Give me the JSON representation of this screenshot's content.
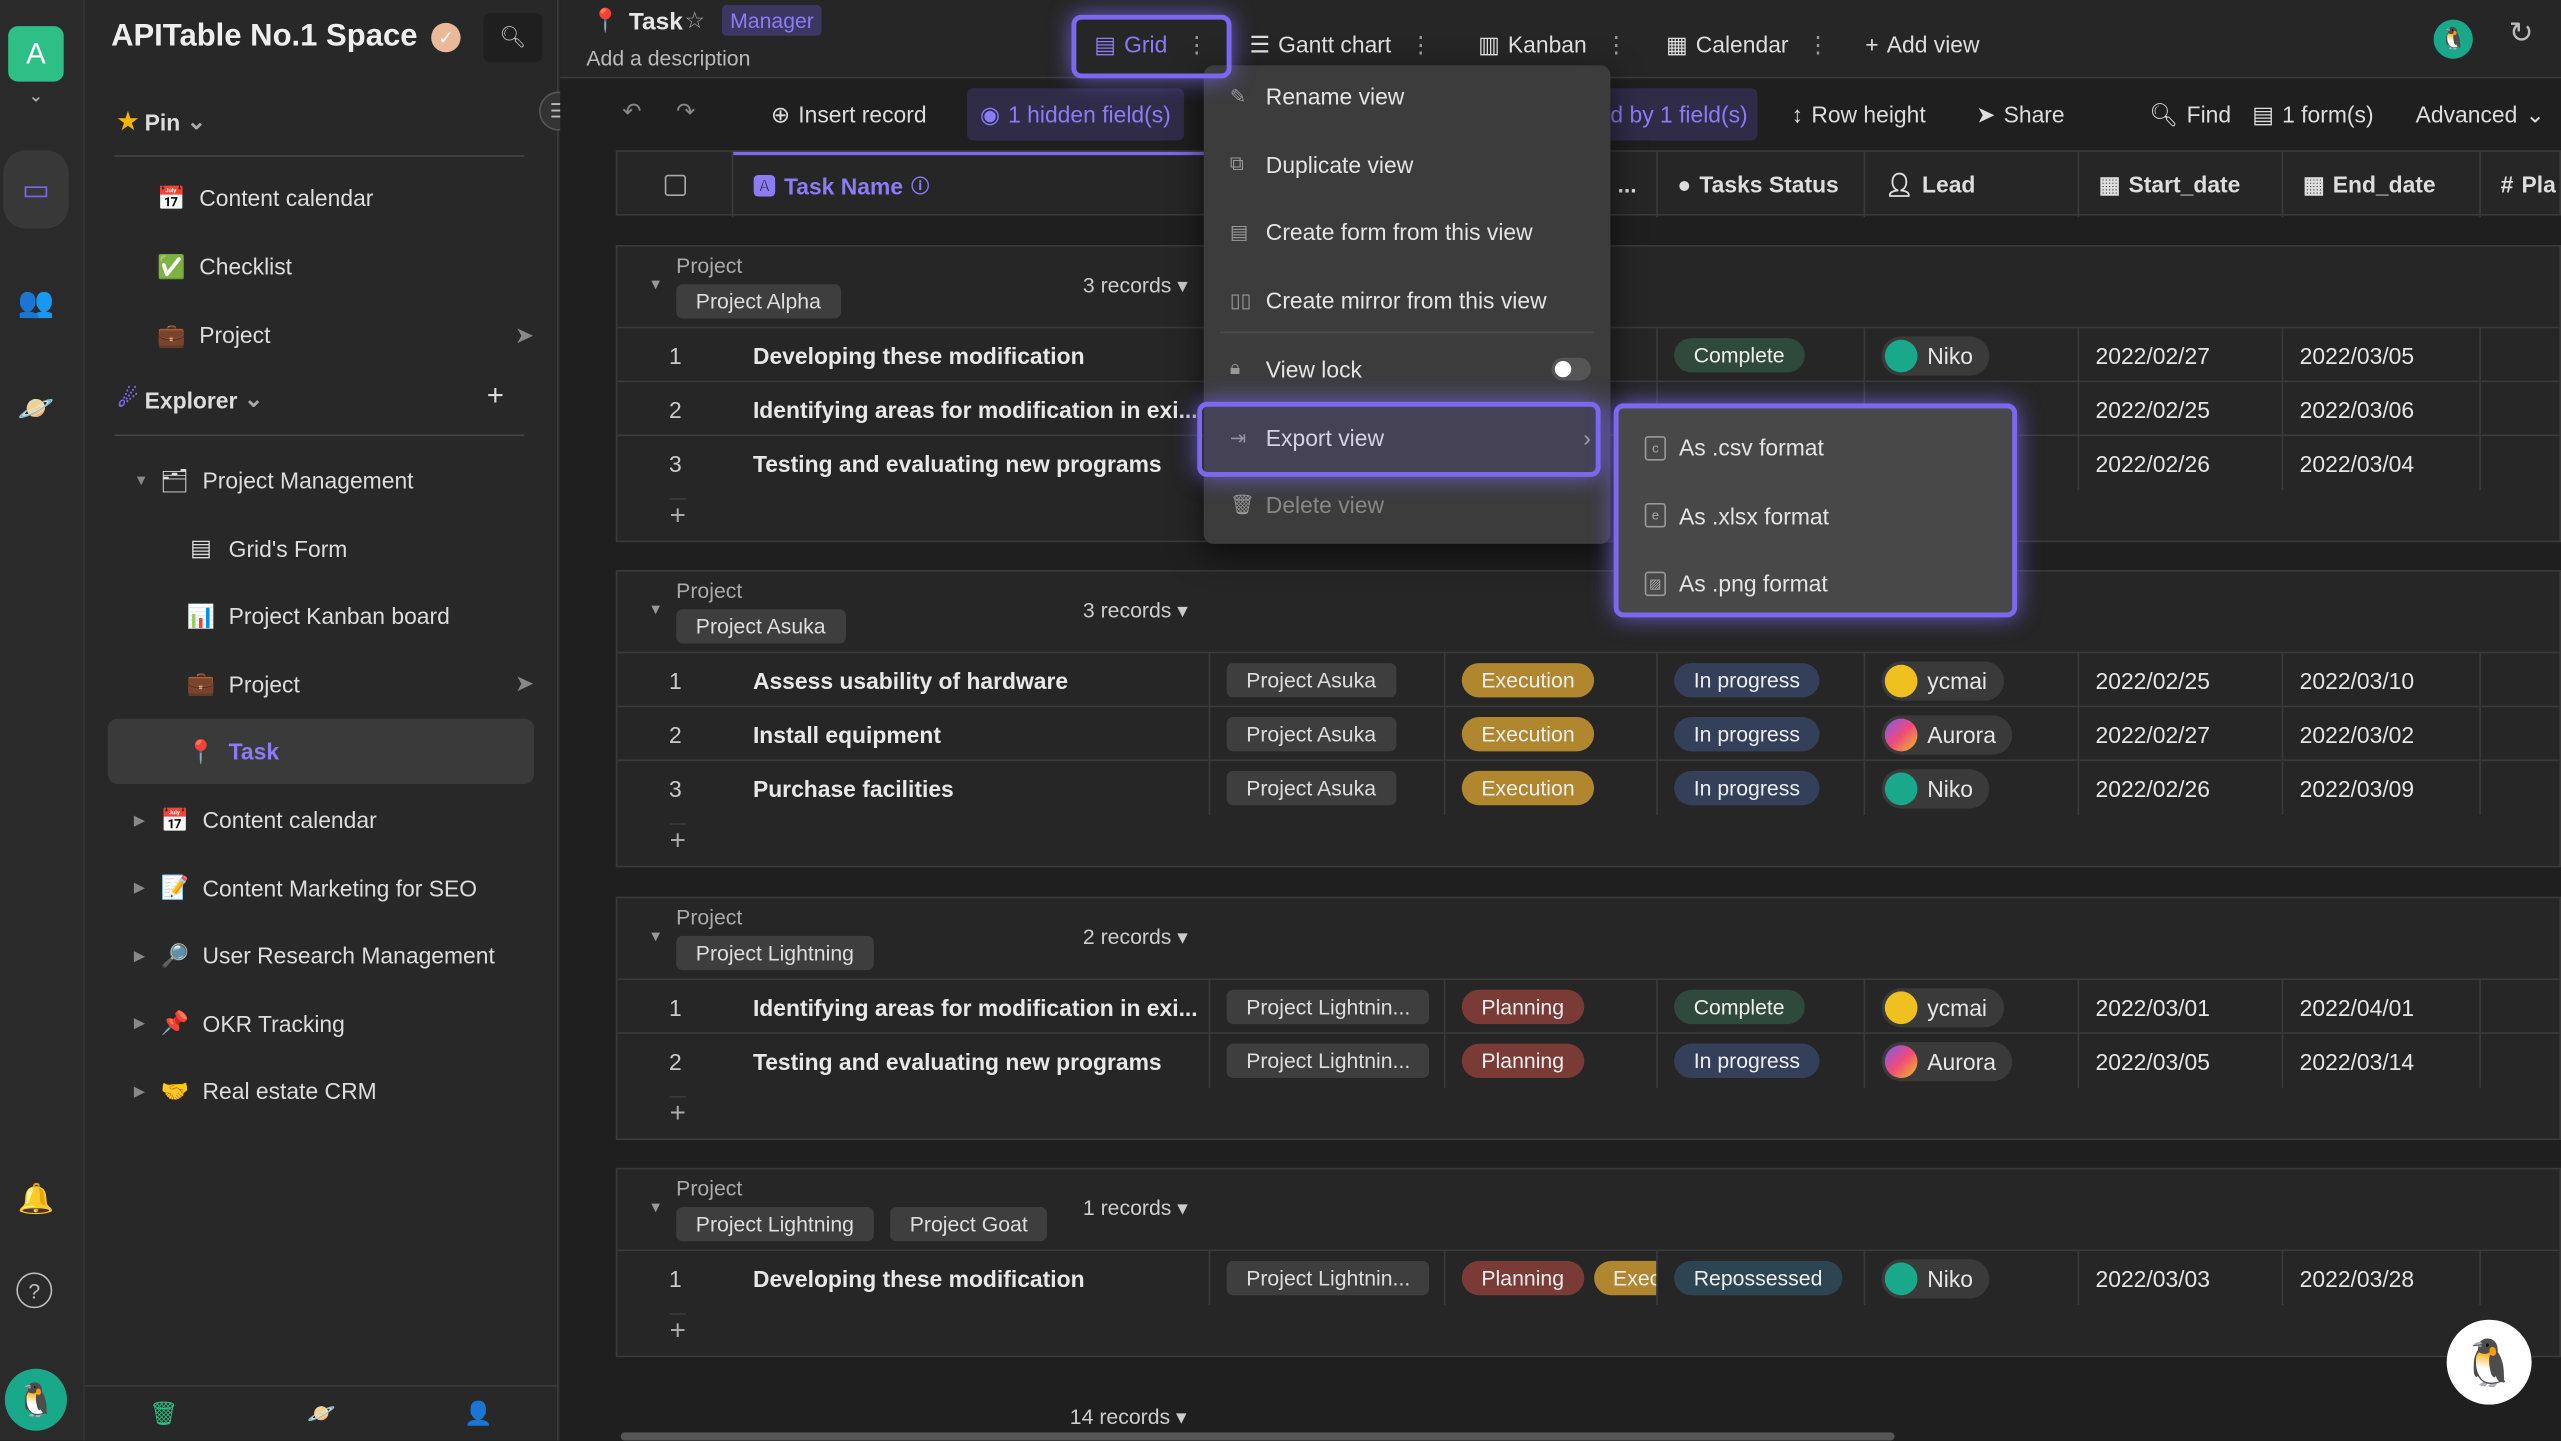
{
  "colors": {
    "accent": "#7b68ee",
    "complete": "#2f4a3c",
    "in_progress": "#34405a",
    "execution": "#b0862e",
    "planning": "#7a3a36",
    "repossessed": "#2d4552",
    "space_avatar": "#2dbf86"
  },
  "rail": {
    "space_letter": "A"
  },
  "sidebar": {
    "space_name": "APITable No.1 Space",
    "pin_label": "Pin",
    "pins": [
      {
        "icon": "📅",
        "label": "Content calendar"
      },
      {
        "icon": "✅",
        "label": "Checklist"
      },
      {
        "icon": "💼",
        "label": "Project"
      }
    ],
    "explorer_label": "Explorer",
    "tree": [
      {
        "icon": "🗂",
        "label": "Project Management",
        "level": 0,
        "expanded": true
      },
      {
        "icon": "▤",
        "label": "Grid's Form",
        "level": 1
      },
      {
        "icon": "📊",
        "label": "Project Kanban board",
        "level": 1
      },
      {
        "icon": "💼",
        "label": "Project",
        "level": 1,
        "shared": true
      },
      {
        "icon": "📍",
        "label": "Task",
        "level": 1,
        "active": true
      },
      {
        "icon": "📅",
        "label": "Content calendar",
        "level": 0
      },
      {
        "icon": "📝",
        "label": "Content Marketing for SEO",
        "level": 0
      },
      {
        "icon": "🔎",
        "label": "User Research Management",
        "level": 0
      },
      {
        "icon": "📌",
        "label": "OKR Tracking",
        "level": 0
      },
      {
        "icon": "🤝",
        "label": "Real estate CRM",
        "level": 0
      }
    ]
  },
  "header": {
    "title": "Task",
    "role": "Manager",
    "description": "Add a description",
    "views": [
      {
        "label": "Grid",
        "icon": "grid-icon",
        "active": true
      },
      {
        "label": "Gantt chart",
        "icon": "gantt-icon"
      },
      {
        "label": "Kanban",
        "icon": "kanban-icon"
      },
      {
        "label": "Calendar",
        "icon": "calendar-icon"
      }
    ],
    "add_view": "Add view"
  },
  "toolbar": {
    "insert": "Insert record",
    "hidden": "1 hidden field(s)",
    "grouped": "d by 1 field(s)",
    "row_height": "Row height",
    "share": "Share",
    "find": "Find",
    "forms": "1 form(s)",
    "advanced": "Advanced"
  },
  "columns": {
    "task": "Task Name",
    "truncated": "...",
    "status": "Tasks Status",
    "lead": "Lead",
    "start": "Start_date",
    "end": "End_date",
    "pla": "Pla"
  },
  "group_field": "Project",
  "groups": [
    {
      "tags": [
        "Project Alpha"
      ],
      "count": "3 records",
      "rows": [
        {
          "n": "1",
          "task": "Developing these modification",
          "status": "Complete",
          "lead": "Niko",
          "start": "2022/02/27",
          "end": "2022/03/05"
        },
        {
          "n": "2",
          "task": "Identifying areas for modification in exi...",
          "start": "2022/02/25",
          "end": "2022/03/06"
        },
        {
          "n": "3",
          "task": "Testing and evaluating new programs",
          "start": "2022/02/26",
          "end": "2022/03/04"
        }
      ]
    },
    {
      "tags": [
        "Project Asuka"
      ],
      "count": "3 records",
      "rows": [
        {
          "n": "1",
          "task": "Assess usability of hardware",
          "project": "Project Asuka",
          "phase": [
            "Execution"
          ],
          "status": "In progress",
          "lead": "ycmai",
          "start": "2022/02/25",
          "end": "2022/03/10"
        },
        {
          "n": "2",
          "task": "Install equipment",
          "project": "Project Asuka",
          "phase": [
            "Execution"
          ],
          "status": "In progress",
          "lead": "Aurora",
          "start": "2022/02/27",
          "end": "2022/03/02"
        },
        {
          "n": "3",
          "task": "Purchase facilities",
          "project": "Project Asuka",
          "phase": [
            "Execution"
          ],
          "status": "In progress",
          "lead": "Niko",
          "start": "2022/02/26",
          "end": "2022/03/09"
        }
      ]
    },
    {
      "tags": [
        "Project Lightning"
      ],
      "count": "2 records",
      "rows": [
        {
          "n": "1",
          "task": "Identifying areas for modification in exi...",
          "project": "Project Lightnin...",
          "phase": [
            "Planning"
          ],
          "status": "Complete",
          "lead": "ycmai",
          "start": "2022/03/01",
          "end": "2022/04/01"
        },
        {
          "n": "2",
          "task": "Testing and evaluating new programs",
          "project": "Project Lightnin...",
          "phase": [
            "Planning"
          ],
          "status": "In progress",
          "lead": "Aurora",
          "start": "2022/03/05",
          "end": "2022/03/14"
        }
      ]
    },
    {
      "tags": [
        "Project Lightning",
        "Project Goat"
      ],
      "count": "1 records",
      "rows": [
        {
          "n": "1",
          "task": "Developing these modification",
          "project": "Project Lightnin...",
          "phase": [
            "Planning",
            "Execu"
          ],
          "status": "Repossessed",
          "lead": "Niko",
          "start": "2022/03/03",
          "end": "2022/03/28"
        }
      ]
    }
  ],
  "footer": {
    "total": "14 records"
  },
  "view_menu": {
    "items": [
      {
        "label": "Rename view"
      },
      {
        "label": "Duplicate view"
      },
      {
        "label": "Create form from this view"
      },
      {
        "label": "Create mirror from this view"
      },
      {
        "label": "View lock",
        "toggle": false
      },
      {
        "label": "Export view",
        "submenu": true,
        "highlighted": true
      },
      {
        "label": "Delete view",
        "disabled": true
      }
    ]
  },
  "export_menu": {
    "items": [
      {
        "label": "As .csv format"
      },
      {
        "label": "As .xlsx format"
      },
      {
        "label": "As .png format"
      }
    ]
  }
}
